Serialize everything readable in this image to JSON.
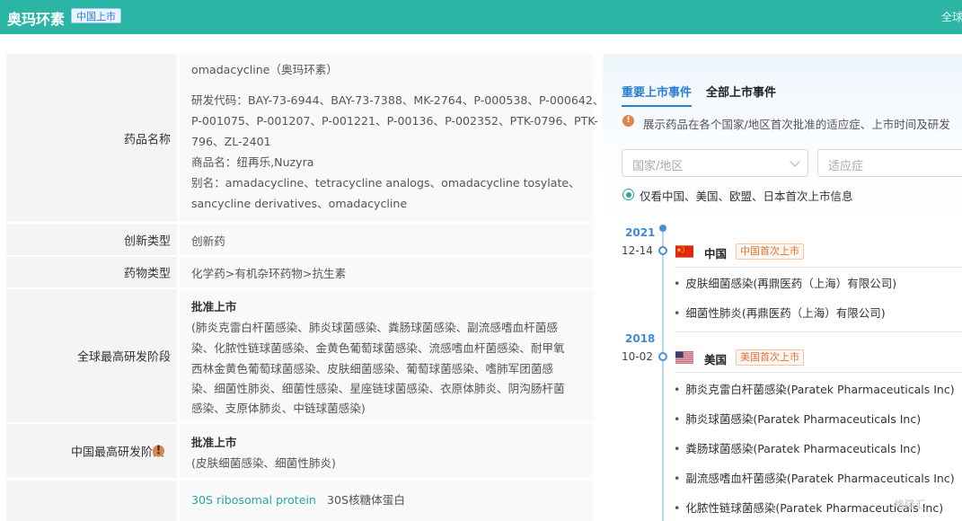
{
  "header": {
    "title": "奥玛环素",
    "badge": "中国上市",
    "right_text": "全球"
  },
  "info": {
    "drug_name": {
      "label": "药品名称",
      "lines": [
        "omadacycline（奥玛环素）",
        "研发代码：BAY-73-6944、BAY-73-7388、MK-2764、P-000538、P-000642、",
        "P-001075、P-001207、P-001221、P-00136、P-002352、PTK-0796、PTK-",
        "796、ZL-2401",
        "商品名：纽再乐,Nuzyra",
        "别名：amadacycline、tetracycline analogs、omadacycline tosylate、",
        "sancycline derivatives、omadacycline"
      ]
    },
    "innovation_type": {
      "label": "创新类型",
      "value": "创新药"
    },
    "drug_type": {
      "label": "药物类型",
      "value": "化学药>有机杂环药物>抗生素"
    },
    "global_stage": {
      "label": "全球最高研发阶段",
      "status": "批准上市",
      "lines": [
        "(肺炎克雷白杆菌感染、肺炎球菌感染、粪肠球菌感染、副流感嗜血杆菌感",
        "染、化脓性链球菌感染、金黄色葡萄球菌感染、流感嗜血杆菌感染、耐甲氧",
        "西林金黄色葡萄球菌感染、皮肤细菌感染、葡萄球菌感染、嗜肺军团菌感",
        "染、细菌性肺炎、细菌性感染、星座链球菌感染、衣原体肺炎、阴沟肠杆菌",
        "感染、支原体肺炎、中链球菌感染)"
      ]
    },
    "china_stage": {
      "label": "中国最高研发阶段",
      "status": "批准上市",
      "detail": "(皮肤细菌感染、细菌性肺炎)"
    },
    "target": {
      "link": "30S ribosomal protein",
      "text": "30S核糖体蛋白"
    }
  },
  "panel": {
    "tabs": [
      "重要上市事件",
      "全部上市事件"
    ],
    "note": "展示药品在各个国家/地区首次批准的适应症、上市时间及研发",
    "filters": {
      "country_placeholder": "国家/地区",
      "indication_placeholder": "适应症"
    },
    "radio_label": "仅看中国、美国、欧盟、日本首次上市信息",
    "events": [
      {
        "year": "2021",
        "date": "12-14",
        "country": "中国",
        "tag": "中国首次上市",
        "items": [
          "皮肤细菌感染(再鼎医药（上海）有限公司)",
          "细菌性肺炎(再鼎医药（上海）有限公司)"
        ]
      },
      {
        "year": "2018",
        "date": "10-02",
        "country": "美国",
        "tag": "美国首次上市",
        "items": [
          "肺炎克雷白杆菌感染(Paratek Pharmaceuticals Inc)",
          "肺炎球菌感染(Paratek Pharmaceuticals Inc)",
          "粪肠球菌感染(Paratek Pharmaceuticals Inc)",
          "副流感嗜血杆菌感染(Paratek Pharmaceuticals Inc)",
          "化脓性链球菌感染(Paratek Pharmaceuticals Inc)"
        ]
      }
    ],
    "watermark": "格隆汇"
  },
  "colors": {
    "header": "#2ab5a5",
    "accent_blue": "#2a7fd1",
    "tag_orange": "#e0743a",
    "link_teal": "#2aa89a"
  }
}
